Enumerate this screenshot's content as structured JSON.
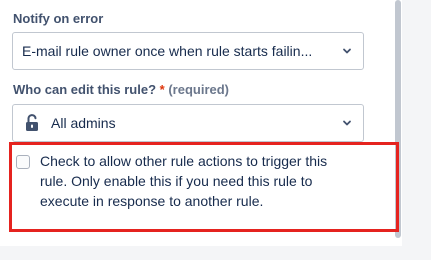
{
  "notify": {
    "label": "Notify on error",
    "value": "E-mail rule owner once when rule starts failin..."
  },
  "who_can_edit": {
    "label": "Who can edit this rule?",
    "required_marker": "*",
    "required_text": "(required)",
    "value": "All admins",
    "icon": "unlock-icon"
  },
  "trigger_option": {
    "checked": false,
    "line1": "Check to allow other rule actions to trigger this",
    "line2": "rule. Only enable this if you need this rule to",
    "line3": "execute in response to another rule."
  },
  "colors": {
    "highlight": "#e5231f",
    "required": "#de350b"
  }
}
